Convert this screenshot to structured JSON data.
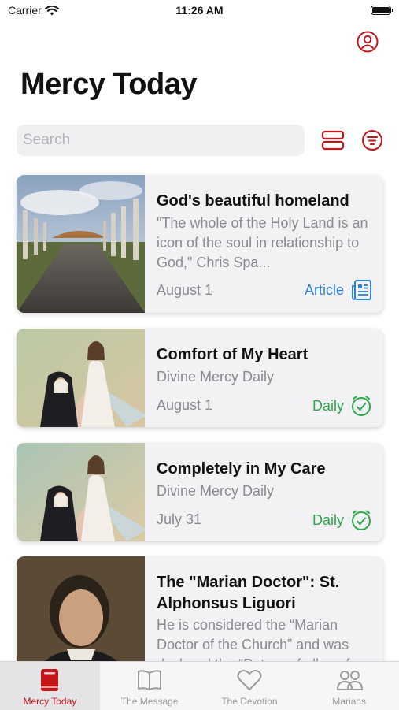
{
  "status_bar": {
    "carrier": "Carrier",
    "time": "11:26 AM"
  },
  "header": {
    "title": "Mercy Today"
  },
  "search": {
    "placeholder": "Search"
  },
  "colors": {
    "accent": "#c3161b",
    "article": "#2f7fd4",
    "daily": "#2ea84a"
  },
  "cards": [
    {
      "title": "God's beautiful homeland",
      "subtitle": "\"The whole of the Holy Land is an icon of the soul in relationship to God,\" Chris Spa...",
      "date": "August 1",
      "type": "Article",
      "type_icon": "newspaper-icon"
    },
    {
      "title": "Comfort of My Heart",
      "subtitle": "Divine Mercy Daily",
      "date": "August 1",
      "type": "Daily",
      "type_icon": "clock-check-icon"
    },
    {
      "title": "Completely in My Care",
      "subtitle": "Divine Mercy Daily",
      "date": "July 31",
      "type": "Daily",
      "type_icon": "clock-check-icon"
    },
    {
      "title": "The \"Marian Doctor\": St. Alphonsus Liguori",
      "subtitle": "He is considered the “Marian Doctor of the Church” and was declared the “Patron of all conf..."
    }
  ],
  "tabs": [
    {
      "label": "Mercy Today",
      "icon": "book-bookmark-icon",
      "active": true
    },
    {
      "label": "The Message",
      "icon": "open-book-icon",
      "active": false
    },
    {
      "label": "The Devotion",
      "icon": "heart-icon",
      "active": false
    },
    {
      "label": "Marians",
      "icon": "people-icon",
      "active": false
    }
  ]
}
